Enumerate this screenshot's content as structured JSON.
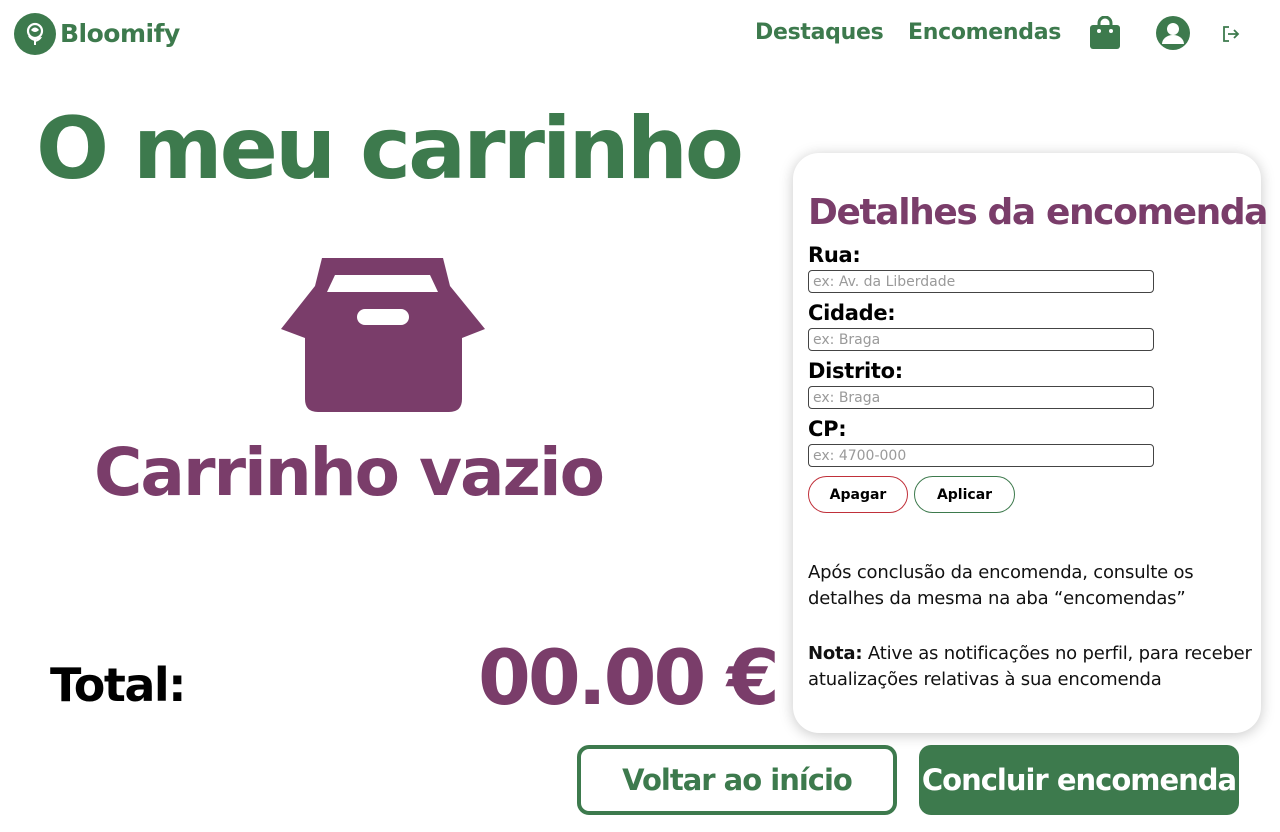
{
  "app": {
    "name": "Bloomify",
    "logo_icon": "rose-icon"
  },
  "nav": {
    "highlights_label": "Destaques",
    "orders_label": "Encomendas",
    "icons": [
      "shopping-bag-icon",
      "user-icon",
      "logout-icon"
    ]
  },
  "cart": {
    "title": "O meu carrinho",
    "empty_icon": "box-icon",
    "empty_text": "Carrinho vazio",
    "total_label": "Total:",
    "total_value": "00.00 €"
  },
  "order_details": {
    "title": "Detalhes da encomenda",
    "fields": [
      {
        "label": "Rua:",
        "placeholder": "ex: Av. da Liberdade",
        "value": ""
      },
      {
        "label": "Cidade:",
        "placeholder": "ex: Braga",
        "value": ""
      },
      {
        "label": "Distrito:",
        "placeholder": "ex: Braga",
        "value": ""
      },
      {
        "label": "CP:",
        "placeholder": "ex: 4700-000",
        "value": ""
      }
    ],
    "clear_label": "Apagar",
    "apply_label": "Aplicar",
    "info_text": "Após conclusão da encomenda, consulte os detalhes da mesma na aba “encomendas”",
    "note_label": "Nota:",
    "note_text": " Ative as notificações no perfil, para receber atualizações relativas à sua encomenda"
  },
  "actions": {
    "back_label": "Voltar ao início",
    "finish_label": "Concluir encomenda"
  },
  "colors": {
    "brand_green": "#3d7a4d",
    "accent_purple": "#7a3d6a",
    "danger_red": "#c0303a"
  }
}
